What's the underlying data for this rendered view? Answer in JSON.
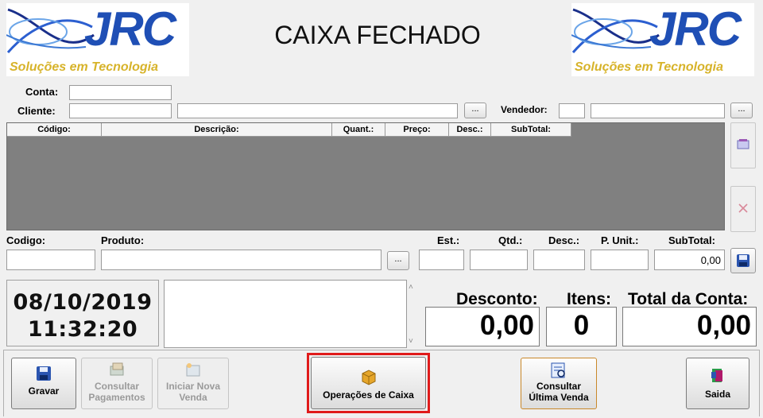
{
  "logo": {
    "brand": "JRC",
    "tagline": "Soluções em Tecnologia"
  },
  "status_title": "CAIXA FECHADO",
  "form": {
    "conta_label": "Conta:",
    "conta_value": "",
    "cliente_label": "Cliente:",
    "cliente_code": "",
    "cliente_name": "",
    "vendedor_label": "Vendedor:",
    "vendedor_code": "",
    "vendedor_name": "",
    "lookup_label": "..."
  },
  "grid": {
    "columns": [
      "Código:",
      "Descrição:",
      "Quant.:",
      "Preço:",
      "Desc.:",
      "SubTotal:"
    ],
    "rows": []
  },
  "entry": {
    "codigo_label": "Codigo:",
    "produto_label": "Produto:",
    "est_label": "Est.:",
    "qtd_label": "Qtd.:",
    "desc_label": "Desc.:",
    "punit_label": "P. Unit.:",
    "subtotal_label": "SubTotal:",
    "subtotal_value": "0,00"
  },
  "clock": {
    "date": "08/10/2019",
    "time": "11:32:20"
  },
  "totals": {
    "desconto_label": "Desconto:",
    "desconto_value": "0,00",
    "itens_label": "Itens:",
    "itens_value": "0",
    "total_label": "Total da Conta:",
    "total_value": "0,00"
  },
  "actions": {
    "gravar": "Gravar",
    "consultar_pagamentos_1": "Consultar",
    "consultar_pagamentos_2": "Pagamentos",
    "iniciar_1": "Iniciar Nova",
    "iniciar_2": "Venda",
    "operacoes": "Operações de Caixa",
    "ultima_1": "Consultar",
    "ultima_2": "Última Venda",
    "saida": "Saida"
  },
  "colors": {
    "brand_blue": "#1f4fb5",
    "brand_gold": "#d7b32a",
    "grid_bg": "#808080",
    "highlight": "#e01b1b"
  }
}
